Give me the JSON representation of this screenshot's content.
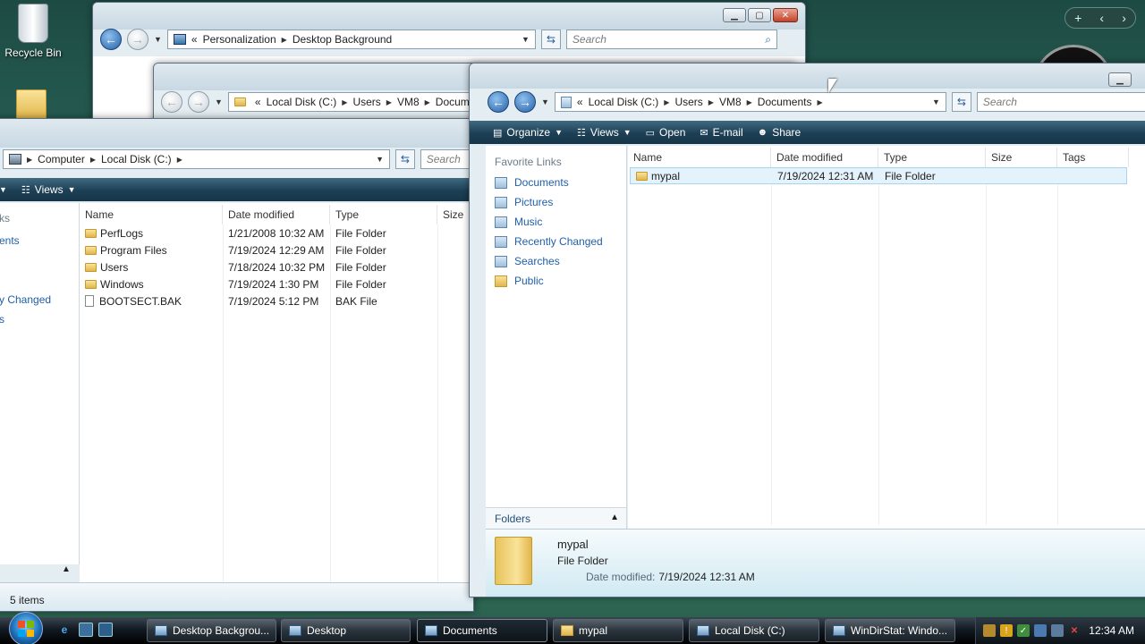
{
  "desktop": {
    "recycle_bin_label": "Recycle Bin"
  },
  "win_personalization": {
    "address": [
      "Personalization",
      "Desktop Background"
    ],
    "search_placeholder": "Search"
  },
  "win_users_behind": {
    "address": [
      "Local Disk (C:)",
      "Users",
      "VM8",
      "Docum"
    ]
  },
  "win_localdisk": {
    "address": [
      "Computer",
      "Local Disk (C:)"
    ],
    "search_placeholder": "Search",
    "toolbar_views": "Views",
    "columns": [
      "Name",
      "Date modified",
      "Type",
      "Size"
    ],
    "rows": [
      {
        "name": "PerfLogs",
        "date": "1/21/2008 10:32 AM",
        "type": "File Folder",
        "kind": "folder"
      },
      {
        "name": "Program Files",
        "date": "7/19/2024 12:29 AM",
        "type": "File Folder",
        "kind": "folder"
      },
      {
        "name": "Users",
        "date": "7/18/2024 10:32 PM",
        "type": "File Folder",
        "kind": "folder"
      },
      {
        "name": "Windows",
        "date": "7/19/2024 1:30 PM",
        "type": "File Folder",
        "kind": "folder"
      },
      {
        "name": "BOOTSECT.BAK",
        "date": "7/19/2024 5:12 PM",
        "type": "BAK File",
        "kind": "file"
      }
    ],
    "left_links_partial": [
      "ks",
      "ents",
      "y Changed",
      "s"
    ],
    "status_items": "5 items"
  },
  "win_documents": {
    "address": [
      "Local Disk (C:)",
      "Users",
      "VM8",
      "Documents"
    ],
    "search_placeholder": "Search",
    "toolbar": {
      "organize": "Organize",
      "views": "Views",
      "open": "Open",
      "email": "E-mail",
      "share": "Share"
    },
    "favorite_links_title": "Favorite Links",
    "favorite_links": [
      "Documents",
      "Pictures",
      "Music",
      "Recently Changed",
      "Searches",
      "Public"
    ],
    "folders_label": "Folders",
    "columns": [
      "Name",
      "Date modified",
      "Type",
      "Size",
      "Tags"
    ],
    "rows": [
      {
        "name": "mypal",
        "date": "7/19/2024 12:31 AM",
        "type": "File Folder"
      }
    ],
    "details": {
      "name": "mypal",
      "type": "File Folder",
      "date_label": "Date modified:",
      "date_value": "7/19/2024 12:31 AM"
    }
  },
  "taskbar": {
    "tasks": [
      {
        "label": "Desktop Backgrou...",
        "icon": "control-panel-icon"
      },
      {
        "label": "Desktop",
        "icon": "desktop-icon"
      },
      {
        "label": "Documents",
        "icon": "documents-icon",
        "active": true
      },
      {
        "label": "mypal",
        "icon": "folder-icon"
      },
      {
        "label": "Local Disk (C:)",
        "icon": "drive-icon"
      },
      {
        "label": "WinDirStat: Windo...",
        "icon": "windirstat-icon"
      }
    ],
    "clock": "12:34 AM"
  }
}
